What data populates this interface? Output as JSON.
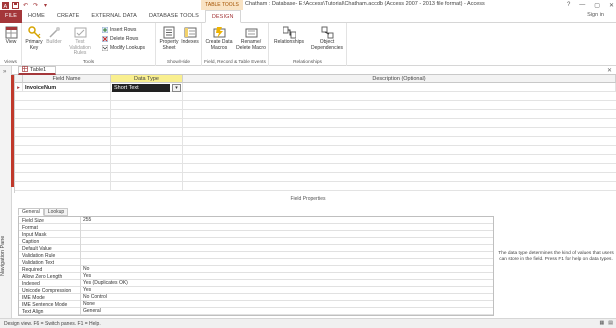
{
  "window": {
    "context_group": "TABLE TOOLS",
    "title": "Chatham : Database- E:\\Access\\Tutorial\\Chatham.accdb (Access 2007 - 2013 file format) - Access",
    "user": "Sign in",
    "controls": [
      "?",
      "—",
      "▢",
      "✕"
    ]
  },
  "tabs": [
    "FILE",
    "HOME",
    "CREATE",
    "EXTERNAL DATA",
    "DATABASE TOOLS",
    "DESIGN"
  ],
  "ribbon": {
    "views": {
      "label": "Views",
      "view": "View"
    },
    "tools": {
      "label": "Tools",
      "primary_key": "Primary Key",
      "builder": "Builder",
      "test_validation": "Test Validation Rules",
      "insert_rows": "Insert Rows",
      "delete_rows": "Delete Rows",
      "modify_lookups": "Modify Lookups"
    },
    "showhide": {
      "label": "Show/Hide",
      "property_sheet": "Property Sheet",
      "indexes": "Indexes"
    },
    "field_events": {
      "label": "Field, Record & Table Events",
      "create_data_macros": "Create Data Macros",
      "rename_delete_macro": "Rename/ Delete Macro"
    },
    "relationships": {
      "label": "Relationships",
      "relationships": "Relationships",
      "object_dependencies": "Object Dependencies"
    }
  },
  "nav_pane": {
    "label": "Navigation Pane"
  },
  "document_tab": {
    "label": "Table1"
  },
  "design_grid": {
    "headers": [
      "Field Name",
      "Data Type",
      "Description (Optional)"
    ],
    "rows": [
      {
        "field_name": "InvoiceNum",
        "data_type": "Short Text",
        "description": ""
      }
    ]
  },
  "field_properties": {
    "title": "Field Properties",
    "tabs": [
      "General",
      "Lookup"
    ],
    "rows": [
      {
        "name": "Field Size",
        "value": "255"
      },
      {
        "name": "Format",
        "value": ""
      },
      {
        "name": "Input Mask",
        "value": ""
      },
      {
        "name": "Caption",
        "value": ""
      },
      {
        "name": "Default Value",
        "value": ""
      },
      {
        "name": "Validation Rule",
        "value": ""
      },
      {
        "name": "Validation Text",
        "value": ""
      },
      {
        "name": "Required",
        "value": "No"
      },
      {
        "name": "Allow Zero Length",
        "value": "Yes"
      },
      {
        "name": "Indexed",
        "value": "Yes (Duplicates OK)"
      },
      {
        "name": "Unicode Compression",
        "value": "Yes"
      },
      {
        "name": "IME Mode",
        "value": "No Control"
      },
      {
        "name": "IME Sentence Mode",
        "value": "None"
      },
      {
        "name": "Text Align",
        "value": "General"
      }
    ],
    "help": "The data type determines the kind of values that users can store in the field. Press F1 for help on data types."
  },
  "status": {
    "text": "Design view.  F6 = Switch panes.  F1 = Help."
  },
  "colors": {
    "accent": "#a4373a",
    "context": "#f9e3c4",
    "selected_header": "#f9ef8f",
    "row_marker": "#c0392b"
  }
}
